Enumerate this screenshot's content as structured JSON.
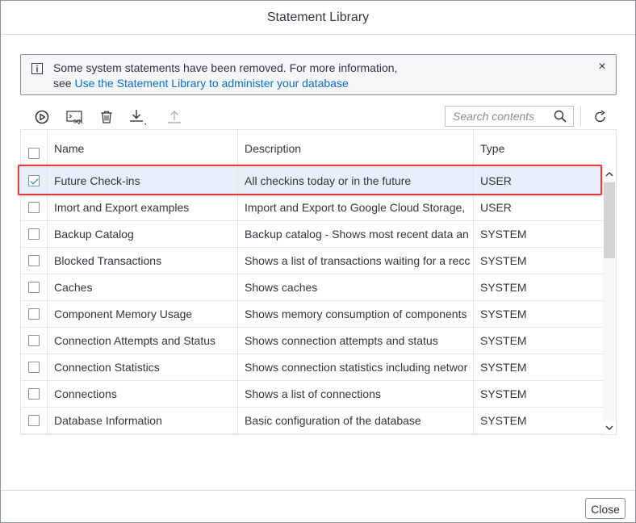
{
  "dialog": {
    "title": "Statement Library",
    "close_label": "Close"
  },
  "message": {
    "line1": "Some system statements have been removed. For more information,",
    "line2_prefix": "see ",
    "link_text": "Use the Statement Library to administer your database",
    "close_symbol": "×"
  },
  "toolbar": {
    "icons": [
      "run-icon",
      "sql-console-icon",
      "delete-icon",
      "download-icon",
      "upload-icon",
      "refresh-icon"
    ],
    "search_placeholder": "Search contents"
  },
  "table": {
    "headers": {
      "name": "Name",
      "description": "Description",
      "type": "Type"
    },
    "rows": [
      {
        "checked": true,
        "name": "Future Check-ins",
        "description": "All checkins today or in the future",
        "type": "USER"
      },
      {
        "checked": false,
        "name": "Imort and Export examples",
        "description": "Import and Export to Google Cloud Storage,",
        "type": "USER"
      },
      {
        "checked": false,
        "name": "Backup Catalog",
        "description": "Backup catalog - Shows most recent data an",
        "type": "SYSTEM"
      },
      {
        "checked": false,
        "name": "Blocked Transactions",
        "description": "Shows a list of transactions waiting for a recc",
        "type": "SYSTEM"
      },
      {
        "checked": false,
        "name": "Caches",
        "description": "Shows caches",
        "type": "SYSTEM"
      },
      {
        "checked": false,
        "name": "Component Memory Usage",
        "description": "Shows memory consumption of components",
        "type": "SYSTEM"
      },
      {
        "checked": false,
        "name": "Connection Attempts and Status",
        "description": "Shows connection attempts and status",
        "type": "SYSTEM"
      },
      {
        "checked": false,
        "name": "Connection Statistics",
        "description": "Shows connection statistics including networ",
        "type": "SYSTEM"
      },
      {
        "checked": false,
        "name": "Connections",
        "description": "Shows a list of connections",
        "type": "SYSTEM"
      },
      {
        "checked": false,
        "name": "Database Information",
        "description": "Basic configuration of the database",
        "type": "SYSTEM"
      }
    ]
  },
  "colors": {
    "accent": "#0a6ed1",
    "highlight": "#e03c3c",
    "selected_row": "#e5f0fa"
  }
}
